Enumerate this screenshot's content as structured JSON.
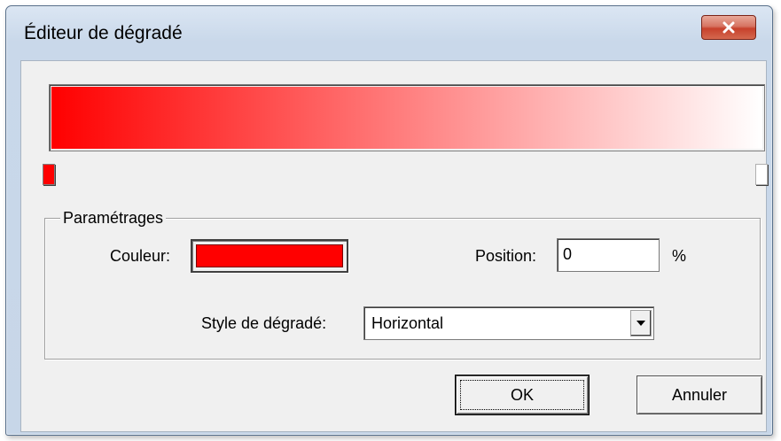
{
  "window": {
    "title": "Éditeur de dégradé",
    "close_icon": "close-x-icon"
  },
  "gradient": {
    "start_color": "#ff0000",
    "end_color": "#ffffff",
    "stops": [
      {
        "position_percent": 0,
        "color": "#ff0000"
      },
      {
        "position_percent": 100,
        "color": "#ffffff"
      }
    ]
  },
  "settings": {
    "group_label": "Paramétrages",
    "color_label": "Couleur:",
    "color_value": "#ff0000",
    "position_label": "Position:",
    "position_value": "0",
    "percent_sign": "%",
    "style_label": "Style de dégradé:",
    "style_value": "Horizontal"
  },
  "buttons": {
    "ok": "OK",
    "cancel": "Annuler"
  }
}
